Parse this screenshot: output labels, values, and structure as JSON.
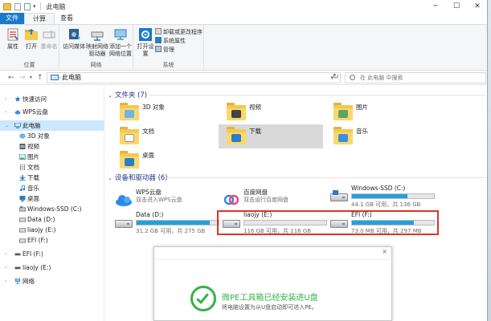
{
  "window": {
    "title": "此电脑"
  },
  "tabs": [
    {
      "label": "文件"
    },
    {
      "label": "计算机"
    },
    {
      "label": "查看"
    }
  ],
  "ribbon": {
    "location": {
      "label": "位置",
      "properties": "属性",
      "open": "打开",
      "rename": "重命名"
    },
    "network": {
      "label": "网络",
      "access_media": "访问媒体",
      "map_drive": "映射网络驱动器",
      "add_location": "添加一个网络位置"
    },
    "system": {
      "label": "系统",
      "open_settings": "打开设置",
      "uninstall": "卸载或更改程序",
      "system_properties": "系统属性",
      "manage": "管理"
    }
  },
  "address": {
    "path": "此电脑",
    "search_placeholder": "在 此电脑 中搜索"
  },
  "nav": [
    {
      "label": "快速访问"
    },
    {
      "label": "WPS云盘"
    },
    {
      "label": "此电脑"
    },
    {
      "label": "3D 对象"
    },
    {
      "label": "视频"
    },
    {
      "label": "图片"
    },
    {
      "label": "文档"
    },
    {
      "label": "下载"
    },
    {
      "label": "音乐"
    },
    {
      "label": "桌面"
    },
    {
      "label": "Windows-SSD (C:)"
    },
    {
      "label": "Data (D:)"
    },
    {
      "label": "liaojy (E:)"
    },
    {
      "label": "EFI (F:)"
    },
    {
      "label": "EFI (F:)"
    },
    {
      "label": "liaojy (E:)"
    },
    {
      "label": "网络"
    }
  ],
  "folders_section": {
    "title": "文件夹 (7)"
  },
  "folders": [
    {
      "name": "3D 对象"
    },
    {
      "name": "视频"
    },
    {
      "name": "图片"
    },
    {
      "name": "文档"
    },
    {
      "name": "下载"
    },
    {
      "name": "音乐"
    },
    {
      "name": "桌面"
    }
  ],
  "devices_section": {
    "title": "设备和驱动器 (6)"
  },
  "drives": [
    {
      "name": "WPS云盘",
      "info": "双击进入WPS云盘",
      "used_fraction": null
    },
    {
      "name": "百度网盘",
      "info": "双击运行百度网盘",
      "used_fraction": null
    },
    {
      "name": "Windows-SSD (C:)",
      "info": "44.1 GB 可用，共 136 GB",
      "used_fraction": 0.68
    },
    {
      "name": "Data (D:)",
      "info": "31.2 GB 可用，共 275 GB",
      "used_fraction": 0.89
    },
    {
      "name": "liaojy (E:)",
      "info": "116 GB 可用，共 116 GB",
      "used_fraction": 0.0
    },
    {
      "name": "EFI (F:)",
      "info": "73.0 MB 可用，共 297 MB",
      "used_fraction": 0.75
    }
  ],
  "popup": {
    "close": "×",
    "message": "微PE工具箱已经安装进U盘",
    "sub": "将电脑设置为从U盘启动即可进入PE。"
  },
  "colors": {
    "accent": "#1979ca",
    "bar_fill": "#26a0da",
    "highlight": "#d9362b",
    "success": "#34b24a"
  }
}
